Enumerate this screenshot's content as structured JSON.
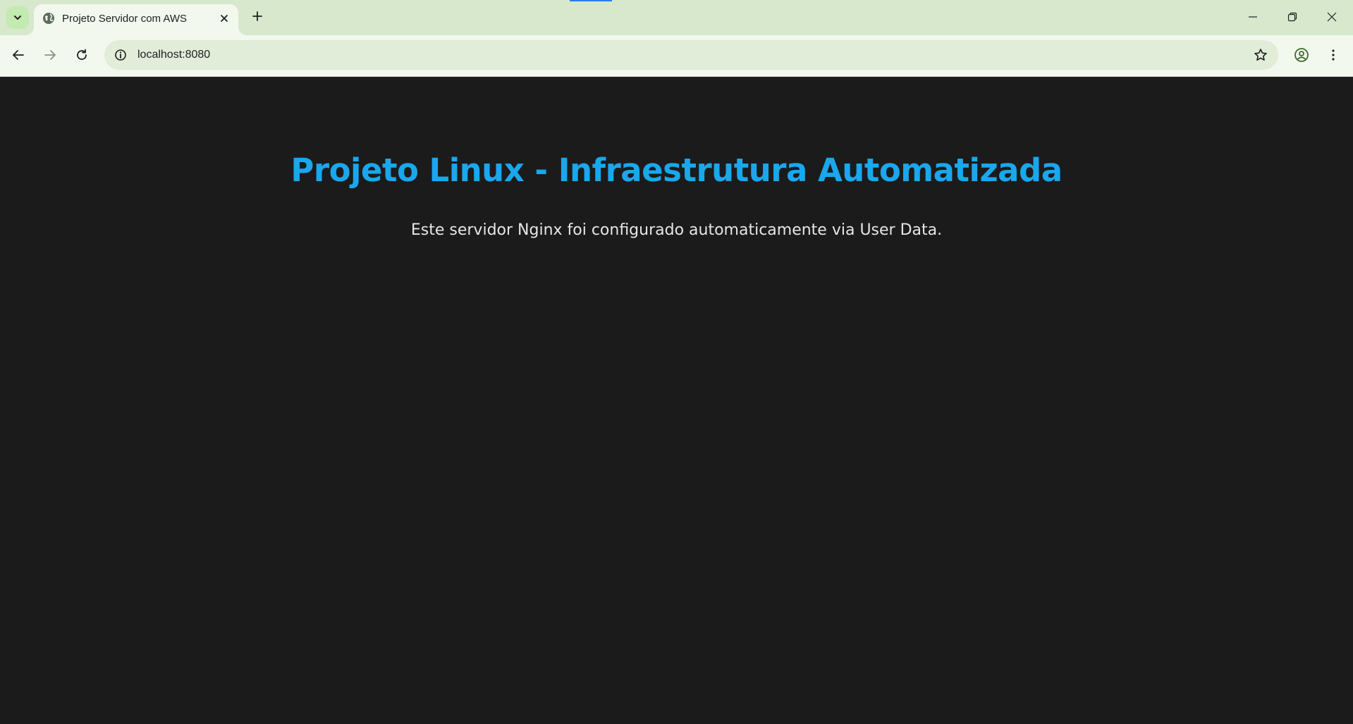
{
  "browser": {
    "tab": {
      "title": "Projeto Servidor com AWS",
      "favicon": "globe-icon"
    },
    "address_bar": {
      "url": "localhost:8080"
    },
    "colors": {
      "tabstrip": "#d7e8cd",
      "toolbar": "#f2f8ee",
      "omnibox": "#e1ecd9"
    }
  },
  "page": {
    "heading": "Projeto Linux - Infraestrutura Automatizada",
    "description": "Este servidor Nginx foi configurado automaticamente via User Data.",
    "colors": {
      "background": "#1b1b1b",
      "heading": "#1aa7ec",
      "text": "#e6e6e6"
    }
  }
}
